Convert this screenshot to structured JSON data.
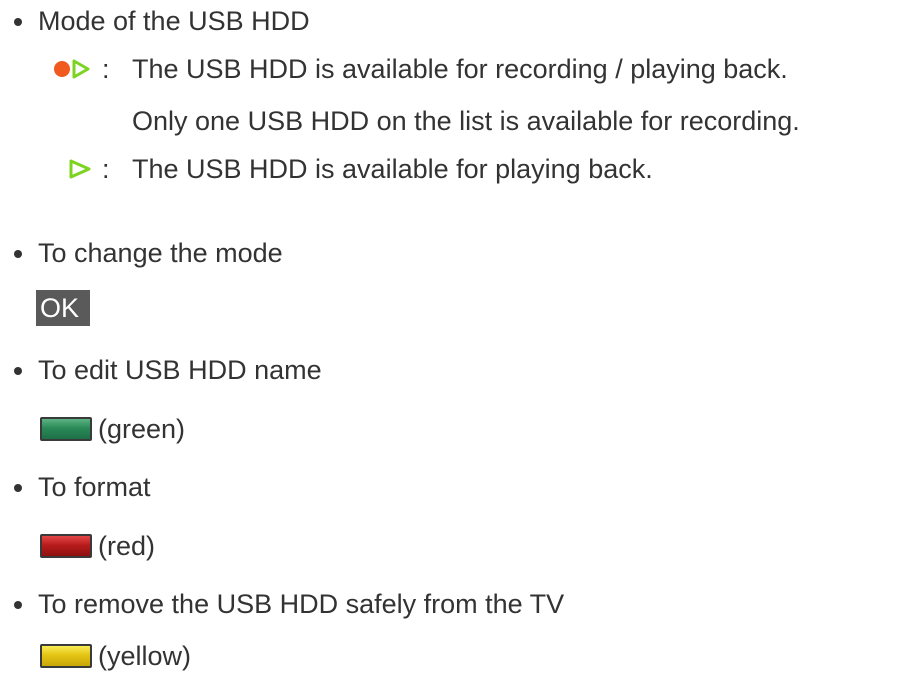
{
  "sections": [
    {
      "heading": "Mode of the USB HDD",
      "modes": [
        {
          "icon": "record-play-icon",
          "separator": ":",
          "text": "The USB HDD is available for recording / playing back.",
          "note": "Only one USB HDD on the list is available for recording."
        },
        {
          "icon": "play-icon",
          "separator": ":",
          "text": "The USB HDD is available for playing back."
        }
      ]
    },
    {
      "heading": "To change the mode",
      "key_label": "OK"
    },
    {
      "heading": "To edit USB HDD name",
      "key_color": "#2a8a58",
      "key_caption": "(green)"
    },
    {
      "heading": "To format",
      "key_color": "#b81c1c",
      "key_caption": "(red)"
    },
    {
      "heading": "To remove the USB HDD safely from the TV",
      "key_color": "#e4c414",
      "key_caption": "(yellow)"
    }
  ],
  "colors": {
    "text": "#333333",
    "record_dot": "#f05a1e",
    "play_triangle": "#7ed321",
    "ok_key_bg": "#5a5a5a"
  }
}
